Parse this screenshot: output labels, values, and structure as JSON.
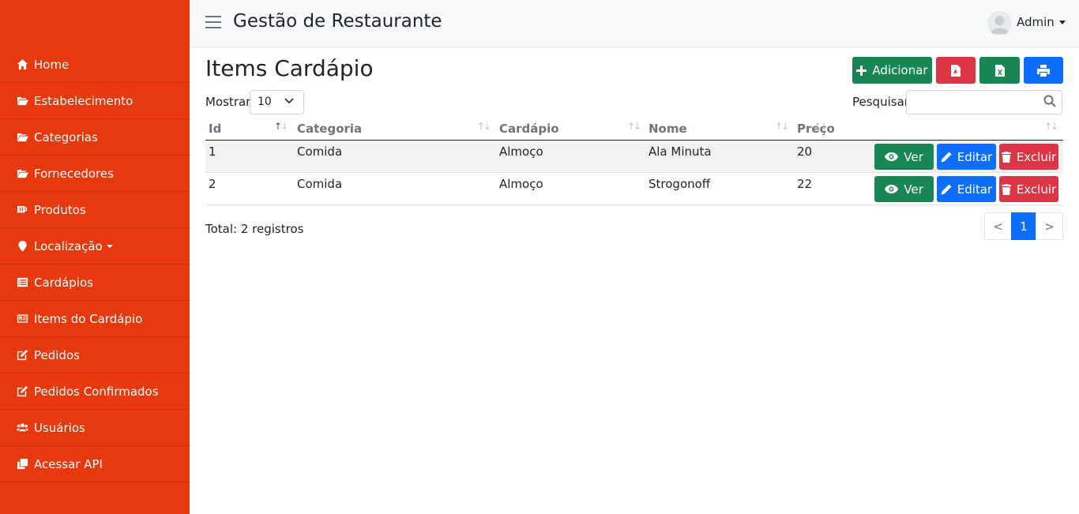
{
  "app": {
    "title": "Gestão de Restaurante",
    "user": "Admin"
  },
  "colors": {
    "sidebar": "#e8380d",
    "success": "#198754",
    "danger": "#dc3545",
    "primary": "#0d6efd"
  },
  "sidebar": {
    "items": [
      {
        "label": "Home",
        "icon": "home-icon"
      },
      {
        "label": "Estabelecimento",
        "icon": "folder-open-icon"
      },
      {
        "label": "Categorias",
        "icon": "folder-open-icon"
      },
      {
        "label": "Fornecedores",
        "icon": "folder-open-icon"
      },
      {
        "label": "Produtos",
        "icon": "mug-icon"
      },
      {
        "label": "Localização",
        "icon": "map-marker-icon"
      },
      {
        "label": "Cardápios",
        "icon": "list-alt-icon"
      },
      {
        "label": "Items do Cardápio",
        "icon": "newspaper-icon"
      },
      {
        "label": "Pedidos",
        "icon": "edit-icon"
      },
      {
        "label": "Pedidos Confirmados",
        "icon": "edit-icon"
      },
      {
        "label": "Usuários",
        "icon": "users-icon"
      },
      {
        "label": "Acessar API",
        "icon": "clone-icon"
      }
    ]
  },
  "page": {
    "title": "Items Cardápio",
    "add_label": "Adicionar",
    "show_label": "Mostrar",
    "page_size": "10",
    "search_label": "Pesquisar",
    "search_value": ""
  },
  "table": {
    "columns": [
      "Id",
      "Categoria",
      "Cardápio",
      "Nome",
      "Preço"
    ],
    "rows": [
      {
        "id": "1",
        "categoria": "Comida",
        "cardapio": "Almoço",
        "nome": "Ala Minuta",
        "preco": "20"
      },
      {
        "id": "2",
        "categoria": "Comida",
        "cardapio": "Almoço",
        "nome": "Strogonoff",
        "preco": "22"
      }
    ],
    "actions": {
      "view": "Ver",
      "edit": "Editar",
      "delete": "Excluir"
    }
  },
  "footer": {
    "total": "Total: 2 registros",
    "prev": "<",
    "current_page": "1",
    "next": ">"
  }
}
